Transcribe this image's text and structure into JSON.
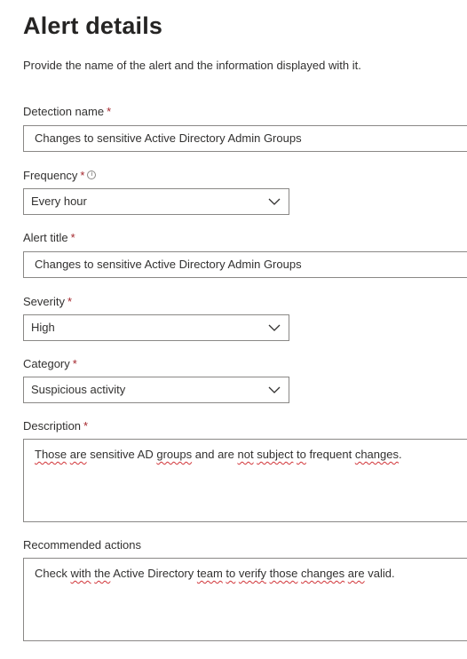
{
  "page": {
    "title": "Alert details",
    "subtitle": "Provide the name of the alert and the information displayed with it."
  },
  "detection_name": {
    "label": "Detection name",
    "required_mark": "*",
    "value": "Changes to sensitive Active Directory Admin Groups"
  },
  "frequency": {
    "label": "Frequency",
    "required_mark": "*",
    "info_icon": "info-circle-icon",
    "selected": "Every hour"
  },
  "alert_title": {
    "label": "Alert title",
    "required_mark": "*",
    "value": "Changes to sensitive Active Directory Admin Groups"
  },
  "severity": {
    "label": "Severity",
    "required_mark": "*",
    "selected": "High"
  },
  "category": {
    "label": "Category",
    "required_mark": "*",
    "selected": "Suspicious activity"
  },
  "description": {
    "label": "Description",
    "required_mark": "*",
    "value": "Those are sensitive AD groups and are not subject to frequent changes."
  },
  "recommended_actions": {
    "label": "Recommended actions",
    "value": "Check with the Active Directory team to verify those changes are valid."
  },
  "colors": {
    "required": "#a4262c",
    "border": "#8a8886",
    "text": "#323130",
    "spellcheck": "#d13438"
  }
}
